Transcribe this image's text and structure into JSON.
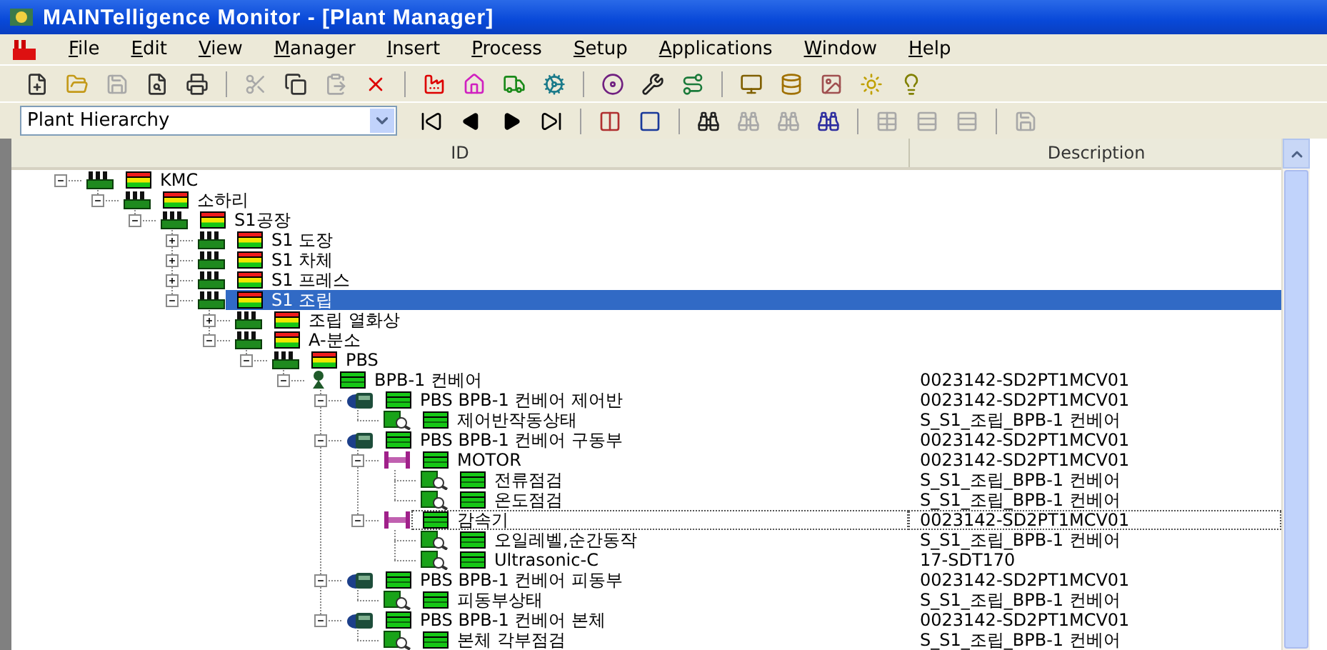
{
  "window": {
    "title": "MAINTelligence Monitor - [Plant Manager]"
  },
  "menu": [
    "File",
    "Edit",
    "View",
    "Manager",
    "Insert",
    "Process",
    "Setup",
    "Applications",
    "Window",
    "Help"
  ],
  "hierarchy_select": {
    "value": "Plant Hierarchy"
  },
  "table": {
    "columns": [
      "ID",
      "Description"
    ],
    "rows": [
      {
        "kind": "factory",
        "label": "KMC",
        "alarm": true,
        "expanded": true,
        "selected": false,
        "focused": false,
        "children": [
          {
            "kind": "factory",
            "label": "소하리",
            "alarm": true,
            "expanded": true,
            "selected": false,
            "focused": false,
            "children": [
              {
                "kind": "factory",
                "label": "S1공장",
                "alarm": true,
                "expanded": true,
                "selected": false,
                "focused": false,
                "children": [
                  {
                    "kind": "factory",
                    "label": "S1 도장",
                    "alarm": true,
                    "expanded": false,
                    "selected": false,
                    "focused": false
                  },
                  {
                    "kind": "factory",
                    "label": "S1 차체",
                    "alarm": true,
                    "expanded": false,
                    "selected": false,
                    "focused": false
                  },
                  {
                    "kind": "factory",
                    "label": "S1 프레스",
                    "alarm": true,
                    "expanded": false,
                    "selected": false,
                    "focused": false
                  },
                  {
                    "kind": "factory",
                    "label": "S1 조립",
                    "alarm": true,
                    "expanded": true,
                    "selected": true,
                    "focused": false,
                    "children": [
                      {
                        "kind": "factory",
                        "label": "조립 열화상",
                        "alarm": true,
                        "expanded": false,
                        "selected": false,
                        "focused": false
                      },
                      {
                        "kind": "factory",
                        "label": "A-분소",
                        "alarm": true,
                        "expanded": true,
                        "selected": false,
                        "focused": false,
                        "children": [
                          {
                            "kind": "factory",
                            "label": "PBS",
                            "alarm": true,
                            "expanded": true,
                            "selected": false,
                            "focused": false,
                            "children": [
                              {
                                "kind": "conveyor",
                                "label": "BPB-1 컨베어",
                                "description": "0023142-SD2PT1MCV01",
                                "alarm": false,
                                "expanded": true,
                                "selected": false,
                                "focused": false,
                                "children": [
                                  {
                                    "kind": "machine",
                                    "label": "PBS BPB-1 컨베어 제어반",
                                    "description": "0023142-SD2PT1MCV01",
                                    "alarm": false,
                                    "expanded": true,
                                    "selected": false,
                                    "focused": false,
                                    "children": [
                                      {
                                        "kind": "sensor",
                                        "label": "제어반작동상태",
                                        "description": "S_S1_조립_BPB-1 컨베어",
                                        "alarm": false,
                                        "selected": false,
                                        "focused": false
                                      }
                                    ]
                                  },
                                  {
                                    "kind": "machine",
                                    "label": "PBS BPB-1 컨베어 구동부",
                                    "description": "0023142-SD2PT1MCV01",
                                    "alarm": false,
                                    "expanded": true,
                                    "selected": false,
                                    "focused": false,
                                    "children": [
                                      {
                                        "kind": "component",
                                        "label": "MOTOR",
                                        "description": "0023142-SD2PT1MCV01",
                                        "alarm": false,
                                        "expanded": true,
                                        "selected": false,
                                        "focused": false,
                                        "children": [
                                          {
                                            "kind": "sensor",
                                            "label": "전류점검",
                                            "description": "S_S1_조립_BPB-1 컨베어",
                                            "alarm": false,
                                            "selected": false,
                                            "focused": false
                                          },
                                          {
                                            "kind": "sensor",
                                            "label": "온도점검",
                                            "description": "S_S1_조립_BPB-1 컨베어",
                                            "alarm": false,
                                            "selected": false,
                                            "focused": false
                                          }
                                        ]
                                      },
                                      {
                                        "kind": "component",
                                        "label": "감속기",
                                        "description": "0023142-SD2PT1MCV01",
                                        "alarm": false,
                                        "expanded": true,
                                        "selected": false,
                                        "focused": true,
                                        "children": [
                                          {
                                            "kind": "sensor",
                                            "label": "오일레벨,순간동작",
                                            "description": "S_S1_조립_BPB-1 컨베어",
                                            "alarm": false,
                                            "selected": false,
                                            "focused": false
                                          },
                                          {
                                            "kind": "sensor",
                                            "label": "Ultrasonic-C",
                                            "description": "17-SDT170",
                                            "alarm": false,
                                            "selected": false,
                                            "focused": false
                                          }
                                        ]
                                      }
                                    ]
                                  },
                                  {
                                    "kind": "machine",
                                    "label": "PBS BPB-1 컨베어 피동부",
                                    "description": "0023142-SD2PT1MCV01",
                                    "alarm": false,
                                    "expanded": true,
                                    "selected": false,
                                    "focused": false,
                                    "children": [
                                      {
                                        "kind": "sensor",
                                        "label": "피동부상태",
                                        "description": "S_S1_조립_BPB-1 컨베어",
                                        "alarm": false,
                                        "selected": false,
                                        "focused": false
                                      }
                                    ]
                                  },
                                  {
                                    "kind": "machine",
                                    "label": "PBS BPB-1 컨베어 본체",
                                    "description": "0023142-SD2PT1MCV01",
                                    "alarm": false,
                                    "expanded": true,
                                    "selected": false,
                                    "focused": false,
                                    "children": [
                                      {
                                        "kind": "sensor",
                                        "label": "본체 각부점검",
                                        "description": "S_S1_조립_BPB-1 컨베어",
                                        "alarm": false,
                                        "selected": false,
                                        "focused": false
                                      }
                                    ]
                                  }
                                ]
                              }
                            ]
                          }
                        ]
                      }
                    ]
                  }
                ]
              }
            ]
          }
        ]
      }
    ]
  }
}
